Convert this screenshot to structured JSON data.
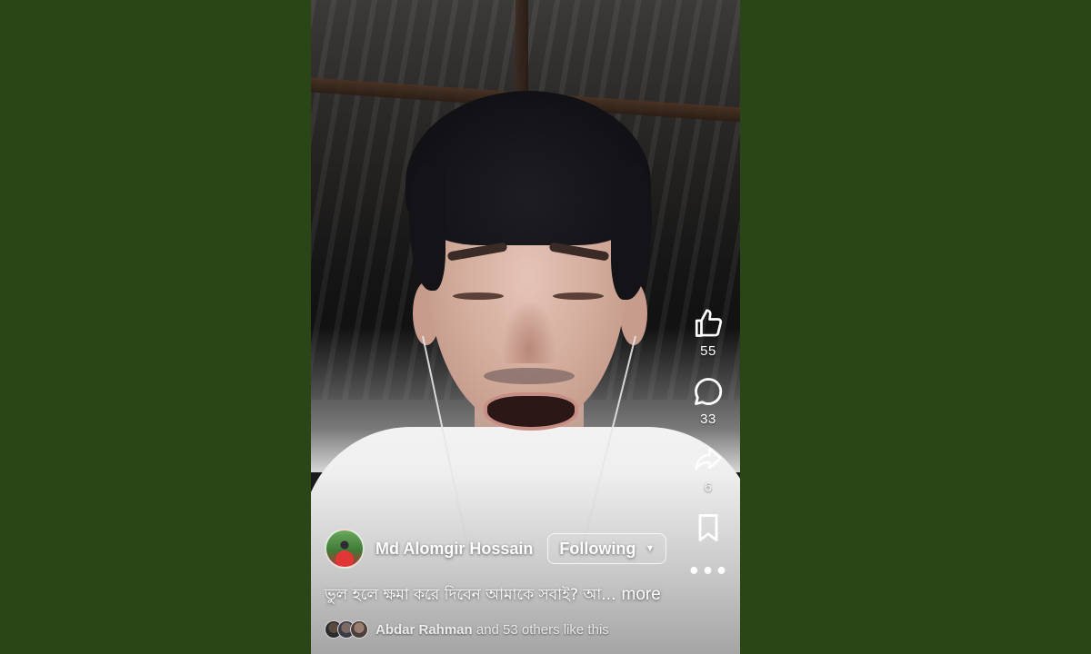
{
  "reel": {
    "actions": {
      "like": {
        "icon": "thumbs-up-icon",
        "count": "55"
      },
      "comment": {
        "icon": "comment-bubble-icon",
        "count": "33"
      },
      "share": {
        "icon": "share-arrow-icon",
        "count": "6"
      },
      "save": {
        "icon": "bookmark-icon"
      },
      "more": {
        "icon": "more-dots-icon",
        "label": "•••"
      }
    },
    "author": {
      "name": "Md Alomgir Hossain",
      "follow_label": "Following",
      "follow_caret": "▼"
    },
    "caption": {
      "text": "ভুল হলে ক্ষমা করে দিবেন আমাকে সবাই? আ...",
      "more_label": "more"
    },
    "likers": {
      "name": "Abdar Rahman",
      "rest": " and 53 others like this"
    }
  },
  "colors": {
    "background": "#2a4516",
    "overlay_text": "#ffffff"
  }
}
